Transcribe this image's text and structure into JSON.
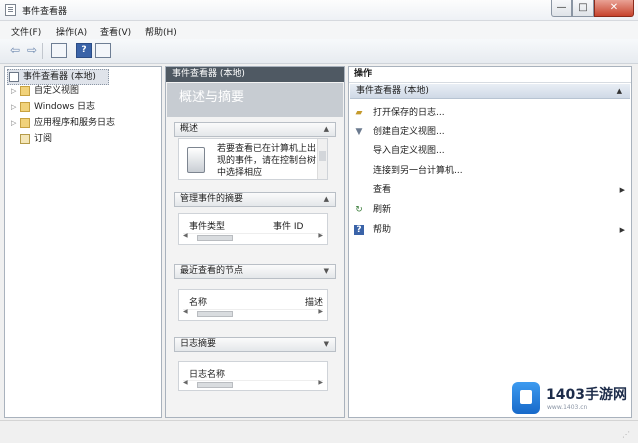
{
  "window": {
    "title": "事件查看器",
    "controls": [
      "—",
      "□",
      "✕"
    ]
  },
  "menu": [
    "文件(F)",
    "操作(A)",
    "查看(V)",
    "帮助(H)"
  ],
  "toolbar": {
    "back": "⇦",
    "forward": "⇨",
    "help": "?"
  },
  "tree": {
    "root": "事件查看器 (本地)",
    "items": [
      "自定义视图",
      "Windows 日志",
      "应用程序和服务日志",
      "订阅"
    ]
  },
  "middle": {
    "header": "事件查看器 (本地)",
    "banner": "概述与摘要",
    "sections": {
      "overview": {
        "title": "概述",
        "text": "若要查看已在计算机上出现的事件，请在控制台树中选择相应"
      },
      "summary": {
        "title": "管理事件的摘要",
        "col1": "事件类型",
        "col2": "事件 ID"
      },
      "recent": {
        "title": "最近查看的节点",
        "col1": "名称",
        "col2": "描述"
      },
      "log": {
        "title": "日志摘要",
        "col1": "日志名称"
      }
    }
  },
  "actions": {
    "header": "操作",
    "group": "事件查看器 (本地)",
    "items": [
      "打开保存的日志...",
      "创建自定义视图...",
      "导入自定义视图...",
      "连接到另一台计算机...",
      "查看",
      "刷新",
      "帮助"
    ]
  },
  "watermark": {
    "brand": "1403手游网",
    "url": "www.1403.cn"
  }
}
